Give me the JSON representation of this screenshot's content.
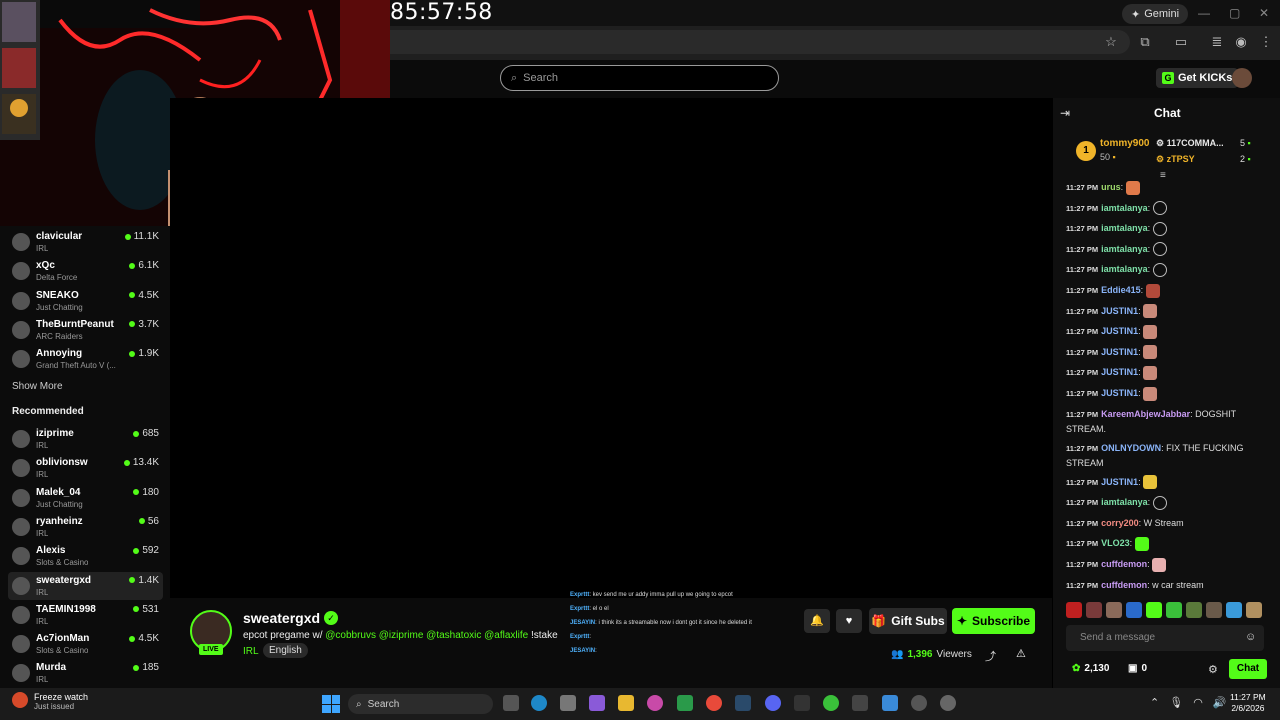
{
  "overlay": {
    "timer": "85:57:58"
  },
  "browser": {
    "gemini_label": "Gemini",
    "controls": [
      "—",
      "▢",
      "✕"
    ]
  },
  "header": {
    "search_placeholder": "Search",
    "get_kicks_label": "Get KICKs"
  },
  "sidebar": {
    "following": [
      {
        "name": "clavicular",
        "category": "IRL",
        "viewers": "11.1K"
      },
      {
        "name": "xQc",
        "category": "Delta Force",
        "viewers": "6.1K"
      },
      {
        "name": "SNEAKO",
        "category": "Just Chatting",
        "viewers": "4.5K"
      },
      {
        "name": "TheBurntPeanut",
        "category": "ARC Raiders",
        "viewers": "3.7K"
      },
      {
        "name": "Annoying",
        "category": "Grand Theft Auto V (...",
        "viewers": "1.9K"
      }
    ],
    "show_more": "Show More",
    "recommended_title": "Recommended",
    "recommended": [
      {
        "name": "iziprime",
        "category": "IRL",
        "viewers": "685"
      },
      {
        "name": "oblivionsw",
        "category": "IRL",
        "viewers": "13.4K"
      },
      {
        "name": "Malek_04",
        "category": "Just Chatting",
        "viewers": "180"
      },
      {
        "name": "ryanheinz",
        "category": "IRL",
        "viewers": "56"
      },
      {
        "name": "Alexis",
        "category": "Slots & Casino",
        "viewers": "592"
      },
      {
        "name": "sweatergxd",
        "category": "IRL",
        "viewers": "1.4K"
      },
      {
        "name": "TAEMIN1998",
        "category": "IRL",
        "viewers": "531"
      },
      {
        "name": "Ac7ionMan",
        "category": "Slots & Casino",
        "viewers": "4.5K"
      },
      {
        "name": "Murda",
        "category": "IRL",
        "viewers": "185"
      }
    ]
  },
  "stream": {
    "live_label": "LIVE",
    "streamer": "sweatergxd",
    "title_prefix": "epcot pregame w/ ",
    "mentions": [
      "@cobbruvs",
      "@iziprime",
      "@tashatoxic",
      "@aflaxlife"
    ],
    "title_suffix": " !stake",
    "category": "IRL",
    "language": "English",
    "gift_label": "Gift Subs",
    "subscribe_label": "Subscribe",
    "viewers_count": "1,396",
    "viewers_label": "Viewers",
    "overlay_chat": [
      {
        "user": "Exprttt",
        "text": ": kev send me ur addy imma pull up we going to epcot"
      },
      {
        "user": "Exprttt",
        "text": ": el o el"
      },
      {
        "user": "JESAYIN",
        "text": ": i think its a streamable now i dont got it since he deleted it"
      },
      {
        "user": "Exprttt",
        "text": ":"
      },
      {
        "user": "JESAYIN",
        "text": ":"
      }
    ]
  },
  "chat": {
    "title": "Chat",
    "leaderboard": {
      "first_rank": "1",
      "first_name": "tommy900",
      "first_score": "50",
      "right": [
        {
          "name": "117COMMA...",
          "score": "5",
          "color": "#e8e8e8"
        },
        {
          "name": "zTPSY",
          "score": "2",
          "color": "#f0b429"
        }
      ]
    },
    "messages": [
      {
        "time": "11:27 PM",
        "user": "urus",
        "color": "#9dd86b",
        "text": "",
        "emote": "#e07a4a"
      },
      {
        "time": "11:27 PM",
        "user": "iamtalanya",
        "color": "#7ee0a8",
        "text": "",
        "emote": "ring"
      },
      {
        "time": "11:27 PM",
        "user": "iamtalanya",
        "color": "#7ee0a8",
        "text": "",
        "emote": "ring"
      },
      {
        "time": "11:27 PM",
        "user": "iamtalanya",
        "color": "#7ee0a8",
        "text": "",
        "emote": "ring"
      },
      {
        "time": "11:27 PM",
        "user": "iamtalanya",
        "color": "#7ee0a8",
        "text": "",
        "emote": "ring"
      },
      {
        "time": "11:27 PM",
        "user": "Eddie415",
        "color": "#8ab4f8",
        "text": "",
        "emote": "#b24a3a"
      },
      {
        "time": "11:27 PM",
        "user": "JUSTIN1",
        "color": "#8ab4f8",
        "text": "",
        "emote": "#c98a7a"
      },
      {
        "time": "11:27 PM",
        "user": "JUSTIN1",
        "color": "#8ab4f8",
        "text": "",
        "emote": "#c98a7a"
      },
      {
        "time": "11:27 PM",
        "user": "JUSTIN1",
        "color": "#8ab4f8",
        "text": "",
        "emote": "#c98a7a"
      },
      {
        "time": "11:27 PM",
        "user": "JUSTIN1",
        "color": "#8ab4f8",
        "text": "",
        "emote": "#c98a7a"
      },
      {
        "time": "11:27 PM",
        "user": "JUSTIN1",
        "color": "#8ab4f8",
        "text": "",
        "emote": "#c98a7a"
      },
      {
        "time": "11:27 PM",
        "user": "KareemAbjewJabbar",
        "color": "#c79bf2",
        "text": " DOGSHIT STREAM.",
        "emote": ""
      },
      {
        "time": "11:27 PM",
        "user": "ONLNYDOWN",
        "color": "#8ab4f8",
        "text": " FIX THE FUCKING STREAM",
        "emote": ""
      },
      {
        "time": "11:27 PM",
        "user": "JUSTIN1",
        "color": "#8ab4f8",
        "text": "",
        "emote": "#e8c23a"
      },
      {
        "time": "11:27 PM",
        "user": "iamtalanya",
        "color": "#7ee0a8",
        "text": "",
        "emote": "ring"
      },
      {
        "time": "11:27 PM",
        "user": "corry200",
        "color": "#f28b82",
        "text": " W Stream",
        "emote": ""
      },
      {
        "time": "11:27 PM",
        "user": "VLO23",
        "color": "#7ee0a8",
        "text": "",
        "emote": "#53fc18"
      },
      {
        "time": "11:27 PM",
        "user": "cuffdemon",
        "color": "#c79bf2",
        "text": "",
        "emote": "#e8b0b0"
      },
      {
        "time": "11:27 PM",
        "user": "cuffdemon",
        "color": "#c79bf2",
        "text": " w car stream",
        "emote": ""
      }
    ],
    "input_placeholder": "Send a message",
    "kick_points": "2,130",
    "channel_points": "0",
    "send_label": "Chat"
  },
  "taskbar": {
    "weather_title": "Freeze watch",
    "weather_sub": "Just issued",
    "search_placeholder": "Search",
    "time": "11:27 PM",
    "date": "2/6/2026"
  },
  "colors": {
    "accent": "#53fc18",
    "background": "#000000"
  }
}
